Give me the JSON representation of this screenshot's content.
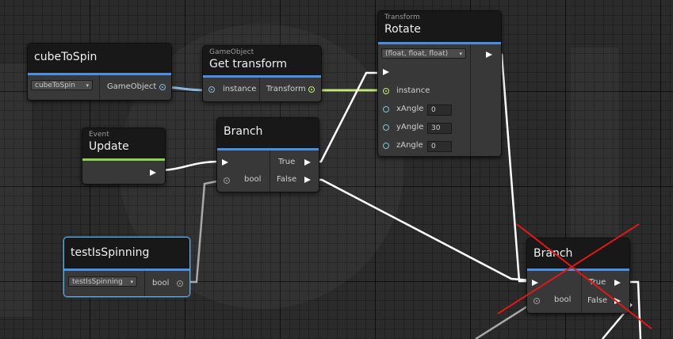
{
  "colors": {
    "background": "#2b2b2b",
    "node_body": "#383838",
    "node_header": "#181818",
    "header_accent": "#4a90e2",
    "event_accent": "#8fd14f",
    "object_wire": "#8ab4d8",
    "transform_wire": "#c6e67a",
    "flow_wire": "#ffffff",
    "bool_wire": "#a8a8a8",
    "selection": "#5cb0e8",
    "cross_mark": "#e01818"
  },
  "nodes": {
    "cube_to_spin": {
      "title": "cubeToSpin",
      "dropdown": "cubeToSpin",
      "output_label": "GameObject"
    },
    "get_transform": {
      "subtitle": "GameObject",
      "title": "Get transform",
      "input_label": "instance",
      "output_label": "Transform"
    },
    "rotate": {
      "subtitle": "Transform",
      "title": "Rotate",
      "overload": "(float, float, float)",
      "instance_label": "instance",
      "x_label": "xAngle",
      "x_value": "0",
      "y_label": "yAngle",
      "y_value": "30",
      "z_label": "zAngle",
      "z_value": "0"
    },
    "update": {
      "subtitle": "Event",
      "title": "Update"
    },
    "branch_1": {
      "title": "Branch",
      "true_label": "True",
      "false_label": "False",
      "condition_label": "bool"
    },
    "test_is_spinning": {
      "title": "testIsSpinning",
      "dropdown": "testIsSpinning",
      "output_label": "bool"
    },
    "branch_2": {
      "title": "Branch",
      "true_label": "True",
      "false_label": "False",
      "condition_label": "bool"
    }
  }
}
